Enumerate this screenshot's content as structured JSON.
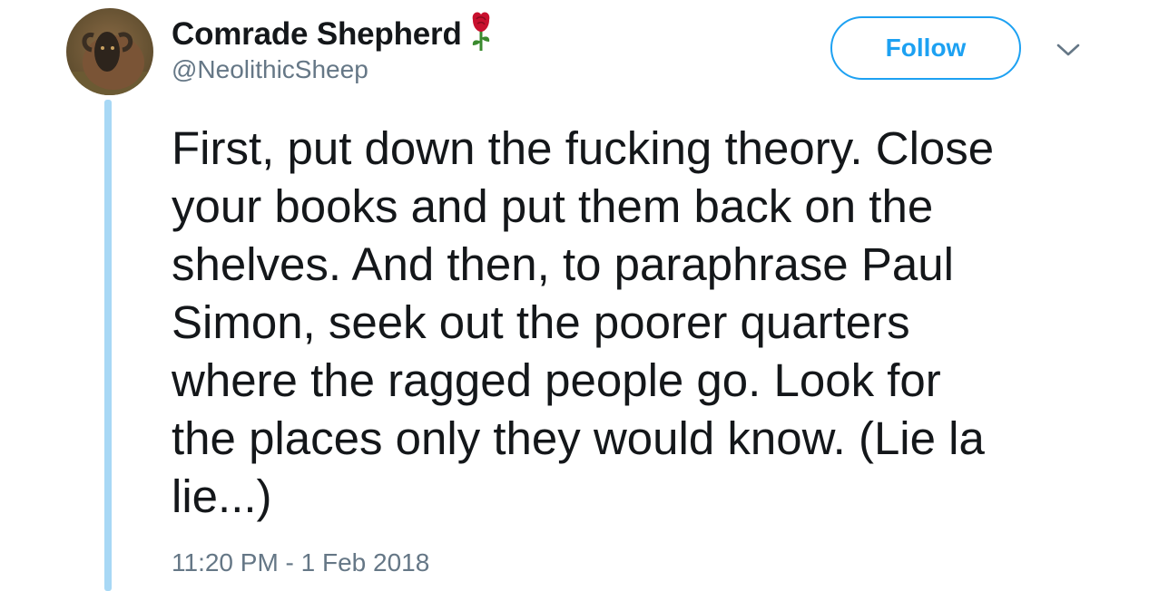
{
  "user": {
    "display_name": "Comrade Shepherd",
    "name_emoji": "rose-icon",
    "handle": "@NeolithicSheep"
  },
  "actions": {
    "follow_label": "Follow",
    "menu_icon": "chevron-down-icon"
  },
  "tweet": {
    "lines": [
      "First, put down the fucking theory. Close",
      "your books and put them back on the",
      "shelves. And then, to paraphrase Paul",
      "Simon, seek out the poorer quarters",
      "where the ragged people go. Look for",
      "the places only they would know. (Lie la",
      "lie...)"
    ],
    "timestamp": "11:20 PM - 1 Feb 2018"
  },
  "colors": {
    "accent": "#1da1f2",
    "thread_line": "#a8d8f5",
    "text": "#14171a",
    "muted": "#657786"
  }
}
